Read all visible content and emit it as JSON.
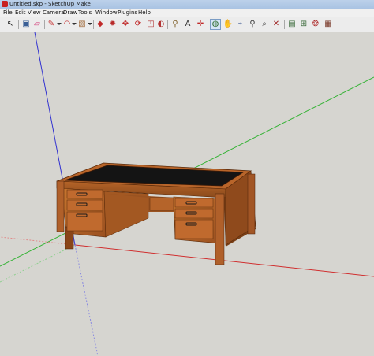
{
  "window": {
    "title": "Untitled.skp - SketchUp Make"
  },
  "menu": {
    "items": [
      "File",
      "Edit",
      "View",
      "Camera",
      "Draw",
      "Tools",
      "Window",
      "Plugins",
      "Help"
    ]
  },
  "toolbar": {
    "tools": [
      {
        "name": "select-icon",
        "glyph": "↖"
      },
      {
        "name": "make-component-icon",
        "glyph": "▣"
      },
      {
        "name": "eraser-icon",
        "glyph": "▱"
      },
      {
        "name": "pencil-line-icon",
        "glyph": "✎"
      },
      {
        "name": "arc-icon",
        "glyph": "◠"
      },
      {
        "name": "shapes-icon",
        "glyph": "▨"
      },
      {
        "name": "push-pull-icon",
        "glyph": "◆"
      },
      {
        "name": "offset-icon",
        "glyph": "✹"
      },
      {
        "name": "move-icon",
        "glyph": "✥"
      },
      {
        "name": "rotate-icon",
        "glyph": "⟳"
      },
      {
        "name": "scale-icon",
        "glyph": "◳"
      },
      {
        "name": "paint-bucket-icon",
        "glyph": "◐"
      },
      {
        "name": "tape-measure-icon",
        "glyph": "⚲"
      },
      {
        "name": "text-icon",
        "glyph": "A"
      },
      {
        "name": "axes-icon",
        "glyph": "✛"
      },
      {
        "name": "orbit-icon",
        "glyph": "◍"
      },
      {
        "name": "pan-icon",
        "glyph": "✋"
      },
      {
        "name": "walk-icon",
        "glyph": "⌁"
      },
      {
        "name": "zoom-icon",
        "glyph": "⚲"
      },
      {
        "name": "zoom-window-icon",
        "glyph": "⌕"
      },
      {
        "name": "zoom-extents-icon",
        "glyph": "✕"
      },
      {
        "name": "warehouse-icon",
        "glyph": "▤"
      },
      {
        "name": "share-model-icon",
        "glyph": "⊞"
      },
      {
        "name": "components-icon",
        "glyph": "❂"
      },
      {
        "name": "extension-warehouse-icon",
        "glyph": "▦"
      }
    ]
  },
  "colors": {
    "viewport_bg": "#d6d5d0",
    "axis_red": "#d03030",
    "axis_green": "#30b030",
    "axis_blue": "#3030d0",
    "wood": "#b8652a",
    "desk_top": "#141414"
  }
}
